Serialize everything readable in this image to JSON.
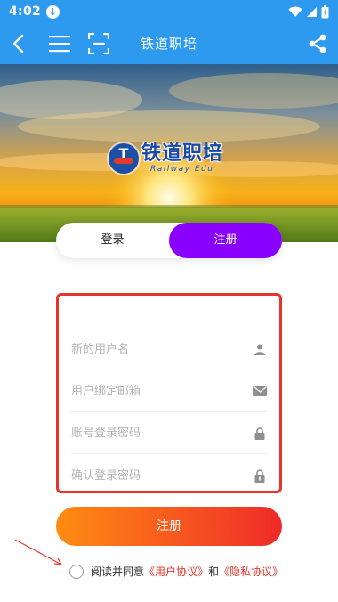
{
  "status_bar": {
    "time": "4:02",
    "download_badge": "↓"
  },
  "header": {
    "title": "铁道职培",
    "back_icon": "back-arrow-icon",
    "menu_icon": "hamburger-menu-icon",
    "scan_icon": "scan-icon",
    "share_icon": "share-icon"
  },
  "banner": {
    "logo_cn": "铁道职培",
    "logo_en": "Railway Edu",
    "logo_mark": "T"
  },
  "tabs": {
    "login": "登录",
    "register": "注册",
    "active": "register"
  },
  "form": {
    "username_placeholder": "新的用户名",
    "email_placeholder": "用户绑定邮箱",
    "password_placeholder": "账号登录密码",
    "confirm_placeholder": "确认登录密码"
  },
  "submit_label": "注册",
  "agreement": {
    "prefix": "阅读并同意",
    "user_agreement": "《用户协议》",
    "and": "和",
    "privacy_agreement": "《隐私协议》",
    "checked": false
  },
  "colors": {
    "header": "#2d9af0",
    "tab_active": "#8a00ff",
    "form_border": "#e8352b",
    "button_start": "#ff8c12",
    "button_end": "#ef2a2a",
    "link": "#e8352b"
  }
}
